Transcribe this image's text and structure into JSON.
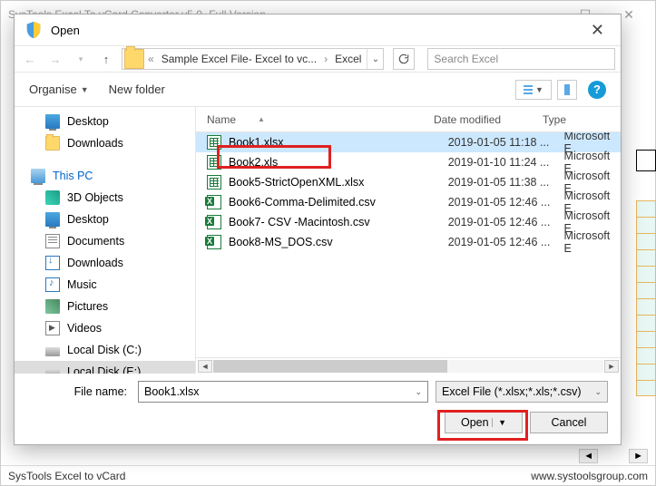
{
  "app": {
    "title": "SysTools Excel To vCard Converter  v5.0- Full Version"
  },
  "dialog": {
    "title": "Open",
    "breadcrumb": {
      "seg1": "Sample Excel File- Excel to vc...",
      "seg2": "Excel"
    },
    "search_placeholder": "Search Excel",
    "toolbar": {
      "organise": "Organise",
      "newfolder": "New folder"
    },
    "columns": {
      "name": "Name",
      "date": "Date modified",
      "type": "Type"
    },
    "filename_label": "File name:",
    "filename_value": "Book1.xlsx",
    "filter": "Excel File (*.xlsx;*.xls;*.csv)",
    "open_btn": "Open",
    "cancel_btn": "Cancel"
  },
  "tree": {
    "desktop": "Desktop",
    "downloads": "Downloads",
    "thispc": "This PC",
    "threed": "3D Objects",
    "desktop2": "Desktop",
    "documents": "Documents",
    "downloads2": "Downloads",
    "music": "Music",
    "pictures": "Pictures",
    "videos": "Videos",
    "localc": "Local Disk (C:)",
    "locale": "Local Disk (E:)"
  },
  "files": [
    {
      "name": "Book1.xlsx",
      "date": "2019-01-05 11:18 ...",
      "type": "Microsoft E",
      "icon": "xls",
      "selected": true
    },
    {
      "name": "Book2.xls",
      "date": "2019-01-10 11:24 ...",
      "type": "Microsoft E",
      "icon": "xls",
      "selected": false
    },
    {
      "name": "Book5-StrictOpenXML.xlsx",
      "date": "2019-01-05 11:38 ...",
      "type": "Microsoft E",
      "icon": "xls",
      "selected": false
    },
    {
      "name": "Book6-Comma-Delimited.csv",
      "date": "2019-01-05 12:46 ...",
      "type": "Microsoft E",
      "icon": "csv",
      "selected": false
    },
    {
      "name": "Book7- CSV -Macintosh.csv",
      "date": "2019-01-05 12:46 ...",
      "type": "Microsoft E",
      "icon": "csv",
      "selected": false
    },
    {
      "name": "Book8-MS_DOS.csv",
      "date": "2019-01-05 12:46 ...",
      "type": "Microsoft E",
      "icon": "csv",
      "selected": false
    }
  ],
  "status": {
    "left": "SysTools Excel to vCard",
    "right": "www.systoolsgroup.com"
  }
}
